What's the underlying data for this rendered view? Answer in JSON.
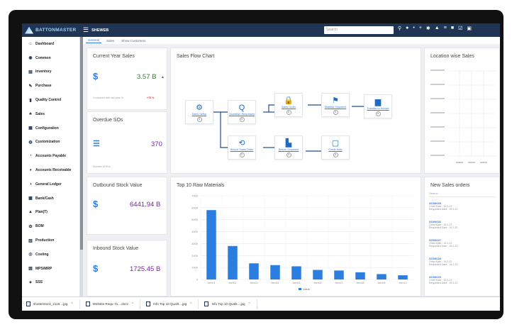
{
  "app": {
    "logo_text": "BATTONMASTER",
    "user_label": "SHEWEB",
    "search_placeholder": "Search"
  },
  "top_icons": [
    "pin-icon",
    "info-icon",
    "dot-icon",
    "plus-icon",
    "gear-icon",
    "alert-icon",
    "grid-icon",
    "chat-icon",
    "check-icon",
    "save-icon"
  ],
  "sidebar": {
    "items": [
      {
        "label": "Dashboard",
        "icon": "home-icon",
        "glyph": "⌂"
      },
      {
        "label": "Common",
        "icon": "globe-icon",
        "glyph": "◉"
      },
      {
        "label": "Inventory",
        "icon": "inventory-icon",
        "glyph": "▤"
      },
      {
        "label": "Purchase",
        "icon": "purchase-icon",
        "glyph": "✎"
      },
      {
        "label": "Quality Control",
        "icon": "quality-icon",
        "glyph": "▮"
      },
      {
        "label": "Sales",
        "icon": "sales-icon",
        "glyph": "♣"
      },
      {
        "label": "Configuration",
        "icon": "configuration-icon",
        "glyph": "▦"
      },
      {
        "label": "Customization",
        "icon": "customization-icon",
        "glyph": "◍"
      },
      {
        "label": "Accounts Payable",
        "icon": "payable-icon",
        "glyph": "◔"
      },
      {
        "label": "Accounts Receivable",
        "icon": "receivable-icon",
        "glyph": "◕"
      },
      {
        "label": "General Ledger",
        "icon": "ledger-icon",
        "glyph": "◑"
      },
      {
        "label": "Bank/Cash",
        "icon": "bank-icon",
        "glyph": "▩"
      },
      {
        "label": "Plan(T)",
        "icon": "plan-icon",
        "glyph": "▲"
      },
      {
        "label": "BOM",
        "icon": "bom-icon",
        "glyph": "✿"
      },
      {
        "label": "Production",
        "icon": "production-icon",
        "glyph": "▥"
      },
      {
        "label": "Costing",
        "icon": "costing-icon",
        "glyph": "◎"
      },
      {
        "label": "MPS/MRP",
        "icon": "mps-icon",
        "glyph": "▧"
      },
      {
        "label": "SSS",
        "icon": "sss-icon",
        "glyph": "✦"
      }
    ]
  },
  "tabs": [
    "General",
    "Sales",
    "Show Customers"
  ],
  "current_year_sales": {
    "title": "Current Year Sales",
    "currency": "$",
    "value": "3.57 B",
    "trend": "▲",
    "footnote": "Compared with last year %",
    "change": "+75 %",
    "colors": {
      "value": "#2e7d32",
      "change": "#d32f2f"
    }
  },
  "overdue_sos": {
    "title": "Overdue SOs",
    "value": "370",
    "footnote": "Number of SOs",
    "icon": "list-icon",
    "colors": {
      "value": "#7b1fa2"
    }
  },
  "outbound_stock": {
    "title": "Outbound Stock Value",
    "currency": "$",
    "value": "6441.94 B",
    "colors": {
      "value": "#7b1fa2"
    }
  },
  "inbound_stock": {
    "title": "Inbound Stock Value",
    "currency": "$",
    "value": "1725.45 B",
    "colors": {
      "value": "#7b1fa2"
    }
  },
  "sales_flow": {
    "title": "Sales Flow Chart",
    "nodes": [
      {
        "label": "Sales Setup",
        "icon": "gears-icon",
        "glyph": "⚙",
        "count": "0"
      },
      {
        "label": "Quotation Requested",
        "icon": "search-icon",
        "glyph": "Q",
        "count": "0"
      },
      {
        "label": "Sales Order",
        "icon": "lock-icon",
        "glyph": "🔒",
        "count": "0"
      },
      {
        "label": "Material Shipment",
        "icon": "shipment-icon",
        "glyph": "⚑",
        "count": "0"
      },
      {
        "label": "Transfer to Invoice",
        "icon": "invoice-icon",
        "glyph": "▆",
        "count": "0"
      },
      {
        "label": "Return Sales Order",
        "icon": "return-icon",
        "glyph": "⟲",
        "count": "0"
      },
      {
        "label": "Return Shipment",
        "icon": "truck-icon",
        "glyph": "▙",
        "count": "0"
      },
      {
        "label": "Credit Note",
        "icon": "note-icon",
        "glyph": "▢",
        "count": "0"
      }
    ]
  },
  "top_raw_materials": {
    "title": "Top 10 Raw Materials",
    "legend": "Value"
  },
  "chart_data": {
    "type": "bar",
    "title": "Top 10 Raw Materials",
    "categories": [
      "Item01",
      "Item02",
      "Item03",
      "Item04",
      "Item05",
      "Item06",
      "Item07",
      "Item08",
      "Item09",
      "Item10"
    ],
    "series": [
      {
        "name": "Value",
        "values": [
          5800,
          2800,
          1350,
          1200,
          1100,
          800,
          750,
          600,
          450,
          350
        ],
        "color": "#2b7de0"
      }
    ],
    "yticks": [
      "0",
      "1000",
      "2000",
      "3000",
      "4000",
      "5000",
      "6000",
      "7000"
    ],
    "ylim": [
      0,
      7000
    ],
    "grid": true,
    "legend_position": "bottom"
  },
  "location_sales": {
    "title": "Location wise Sales"
  },
  "new_sales_orders": {
    "title": "New Sales orders",
    "search_placeholder": "Search",
    "orders": [
      {
        "id": "SO00025",
        "line1": "Order Date : 19-2-22",
        "line2": "Requested Date : 19-2-22"
      },
      {
        "id": "SO00026",
        "line1": "Order Date : 19-2-22",
        "line2": "Requested Date : 19-2-22"
      },
      {
        "id": "SO00027",
        "line1": "Order Date : 19-2-22",
        "line2": "Requested Date : 19-2-22"
      },
      {
        "id": "SO00028",
        "line1": "Order Date : 19-2-22",
        "line2": "Requested Date : 19-2-22"
      },
      {
        "id": "SO00029",
        "line1": "Order Date : 19-2-22",
        "line2": "Requested Date : 19-2-22"
      }
    ]
  },
  "downloads": [
    {
      "name": "shutterstock_2116....jpg"
    },
    {
      "name": "Website Requ- fo....docx"
    },
    {
      "name": "Info Top 10 Qualit....jpg"
    },
    {
      "name": "Info Top 10 Qualit....jpg"
    }
  ]
}
